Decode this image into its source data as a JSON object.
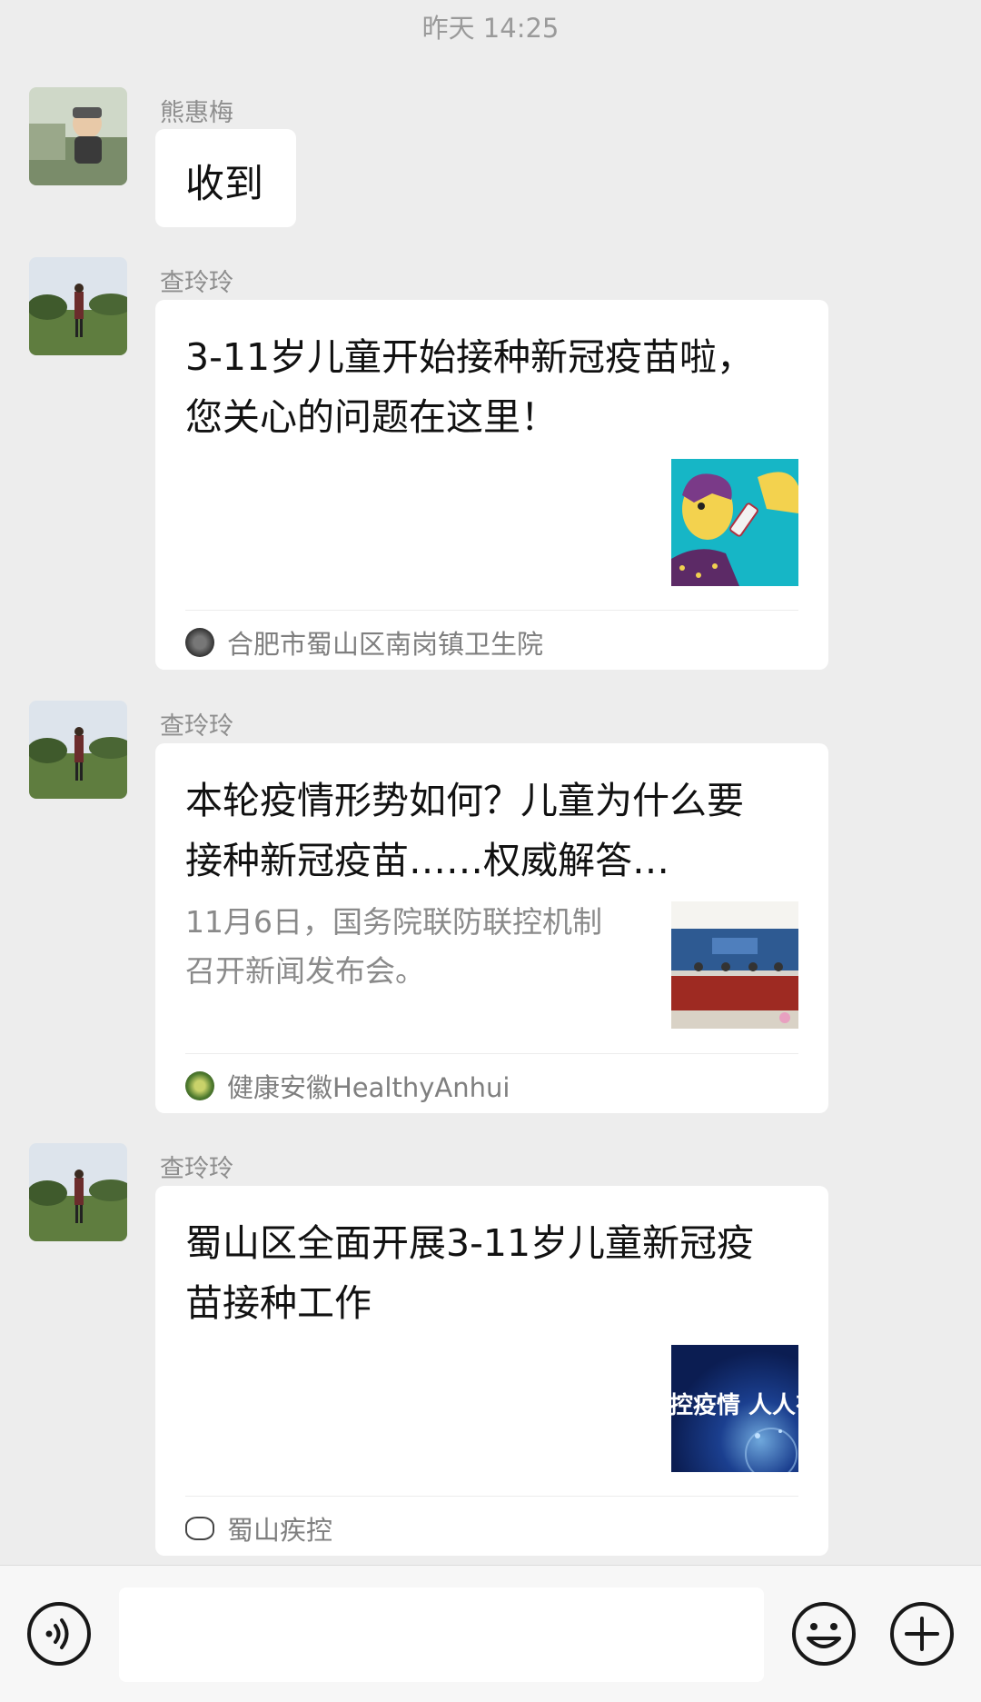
{
  "chat": {
    "timestamp": "昨天 14:25",
    "messages": [
      {
        "sender": "熊惠梅",
        "type": "text",
        "text": "收到"
      },
      {
        "sender": "查玲玲",
        "type": "card",
        "title": "3-11岁儿童开始接种新冠疫苗啦，您关心的问题在这里！",
        "description": "",
        "source": "合肥市蜀山区南岗镇卫生院",
        "thumbnail": "vaccination-illustration"
      },
      {
        "sender": "查玲玲",
        "type": "card",
        "title": "本轮疫情形势如何？儿童为什么要接种新冠疫苗……权威解答…",
        "description": "11月6日，国务院联防联控机制召开新闻发布会。",
        "source": "健康安徽HealthyAnhui",
        "thumbnail": "press-conference-photo"
      },
      {
        "sender": "查玲玲",
        "type": "card",
        "title": "蜀山区全面开展3-11岁儿童新冠疫苗接种工作",
        "description": "",
        "source": "蜀山疾控",
        "thumbnail": "epidemic-prevention-banner",
        "thumbnail_text": "控疫情 人人有"
      }
    ]
  },
  "toolbar": {
    "voice_icon": "voice-icon",
    "emoji_icon": "emoji-icon",
    "plus_icon": "plus-icon",
    "input_value": ""
  },
  "colors": {
    "background": "#ededed",
    "bubble": "#ffffff",
    "toolbar": "#f7f7f7"
  }
}
